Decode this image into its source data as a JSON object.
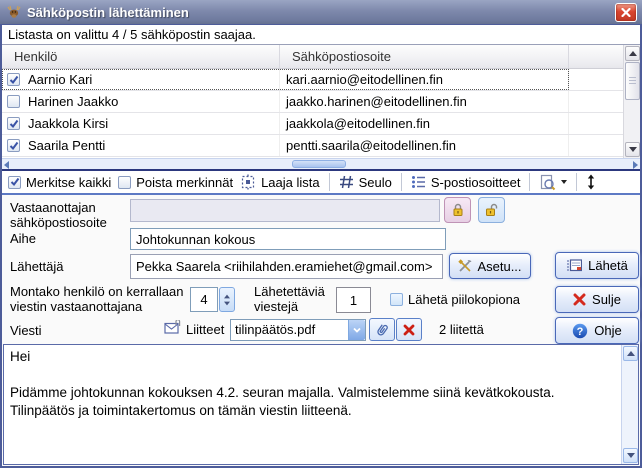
{
  "window": {
    "title": "Sähköpostin lähettäminen"
  },
  "status_text": "Listasta on valittu 4 / 5 sähköpostin saajaa.",
  "table": {
    "col_person": "Henkilö",
    "col_email": "Sähköpostiosoite",
    "rows": [
      {
        "name": "Aarnio Kari",
        "email": "kari.aarnio@eitodellinen.fin",
        "checked": true,
        "selected": true
      },
      {
        "name": "Harinen Jaakko",
        "email": "jaakko.harinen@eitodellinen.fin",
        "checked": false,
        "selected": false
      },
      {
        "name": "Jaakkola Kirsi",
        "email": "jaakkola@eitodellinen.fin",
        "checked": true,
        "selected": false
      },
      {
        "name": "Saarila Pentti",
        "email": "pentti.saarila@eitodellinen.fin",
        "checked": true,
        "selected": false
      }
    ]
  },
  "toolbar": {
    "mark_all": {
      "label": "Merkitse kaikki",
      "checked": true
    },
    "clear_marks": {
      "label": "Poista merkinnät",
      "checked": false
    },
    "wide_list_label": "Laaja lista",
    "filter_label": "Seulo",
    "addresses_label": "S-postiosoitteet"
  },
  "form": {
    "recipient_label": "Vastaanottajan sähköpostiosoite",
    "recipient_value": "",
    "subject_label": "Aihe",
    "subject_value": "Johtokunnan kokous",
    "sender_label": "Lähettäjä",
    "sender_value": "Pekka Saarela <riihilahden.eramiehet@gmail.com>",
    "settings_label": "Asetu...",
    "batch_label": "Montako henkilö on kerrallaan viestin vastaanottajana",
    "batch_value": "4",
    "per_send_label": "Lähetettäviä viestejä",
    "per_send_value": "1",
    "bcc": {
      "label": "Lähetä piilokopiona",
      "checked": false
    },
    "message_label": "Viesti",
    "attachments_label": "Liitteet",
    "attachment_selected": "tilinpäätös.pdf",
    "attachments_count": "2 liitettä",
    "message_text": "Hei\n\nPidämme johtokunnan kokouksen 4.2. seuran majalla. Valmistelemme siinä kevätkokousta.\nTilinpäätös ja toimintakertomus on tämän viestin liitteenä."
  },
  "buttons": {
    "send": "Lähetä",
    "close": "Sulje",
    "help": "Ohje",
    "help_glyph": "?"
  },
  "colors": {
    "titlebar": "#7e89ac",
    "accent": "#4f6bbd",
    "close_red": "#d9452f",
    "lock_closed_bg": "#e7cfe4",
    "lock_open_bg": "#cfe2f8"
  }
}
